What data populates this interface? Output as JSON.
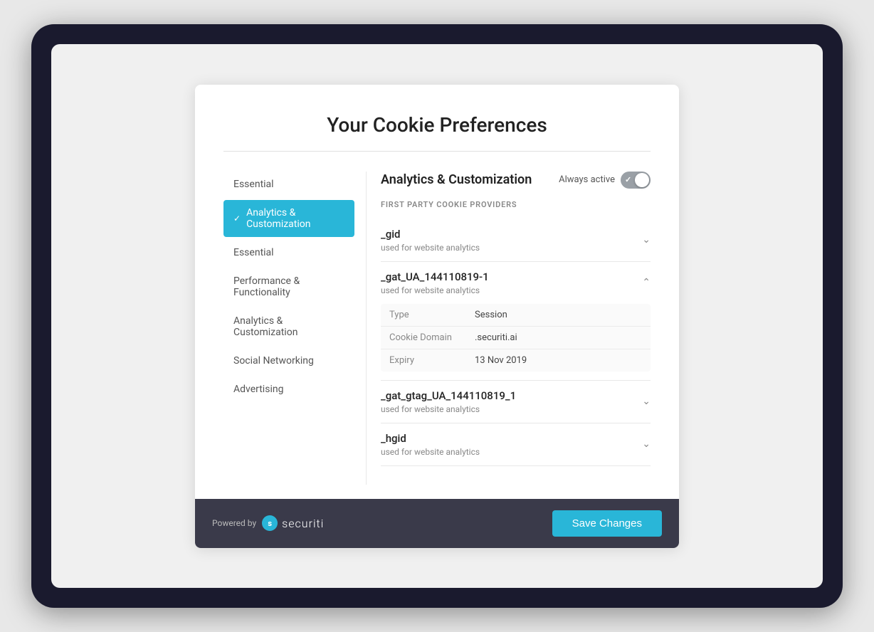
{
  "modal": {
    "title": "Your Cookie Preferences"
  },
  "sidebar": {
    "items": [
      {
        "id": "essential-top",
        "label": "Essential",
        "active": false
      },
      {
        "id": "analytics-customization",
        "label": "Analytics & Customization",
        "active": true
      },
      {
        "id": "essential",
        "label": "Essential",
        "active": false
      },
      {
        "id": "performance-functionality",
        "label": "Performance & Functionality",
        "active": false
      },
      {
        "id": "analytics-customization-2",
        "label": "Analytics & Customization",
        "active": false
      },
      {
        "id": "social-networking",
        "label": "Social Networking",
        "active": false
      },
      {
        "id": "advertising",
        "label": "Advertising",
        "active": false
      }
    ]
  },
  "panel": {
    "title": "Analytics & Customization",
    "always_active_label": "Always active",
    "section_label": "FIRST PARTY COOKIE PROVIDERS",
    "cookies": [
      {
        "name": "_gid",
        "description": "used for website analytics",
        "expanded": false
      },
      {
        "name": "_gat_UA_144110819-1",
        "description": "used for website analytics",
        "expanded": true,
        "details": [
          {
            "label": "Type",
            "value": "Session"
          },
          {
            "label": "Cookie Domain",
            "value": ".securiti.ai"
          },
          {
            "label": "Expiry",
            "value": "13 Nov 2019"
          }
        ]
      },
      {
        "name": "_gat_gtag_UA_144110819_1",
        "description": "used for website analytics",
        "expanded": false
      },
      {
        "name": "_hgid",
        "description": "used for website analytics",
        "expanded": false
      }
    ]
  },
  "footer": {
    "powered_by_label": "Powered by",
    "brand_name": "securiti",
    "save_button_label": "Save Changes"
  }
}
